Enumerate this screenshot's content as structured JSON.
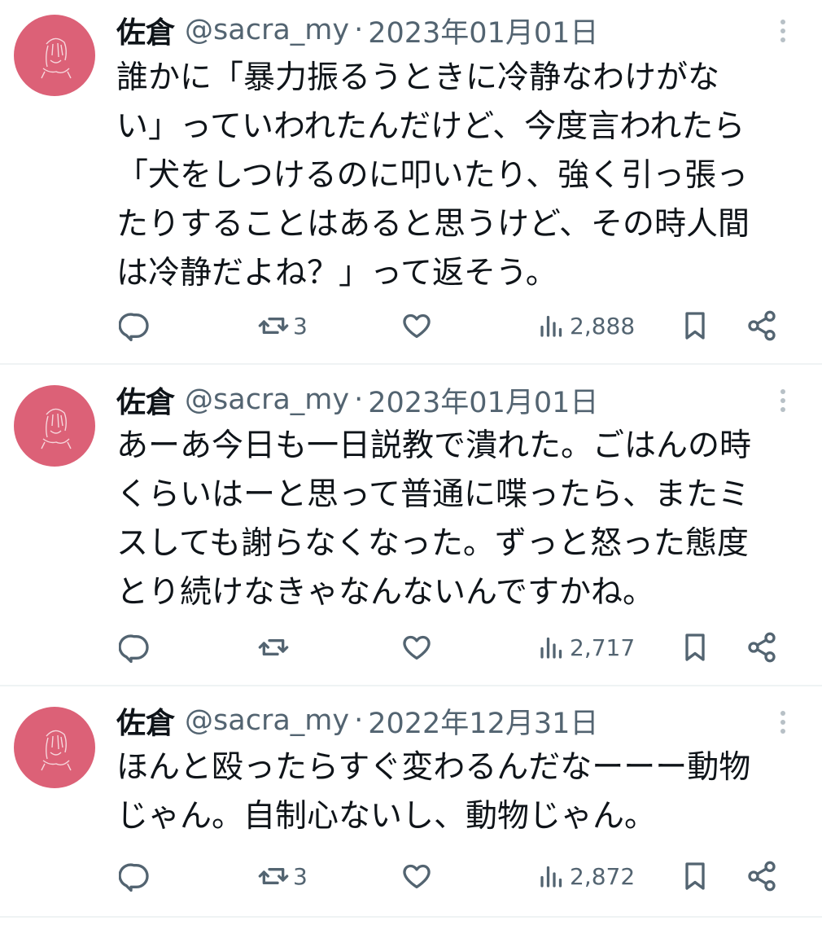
{
  "tweets": [
    {
      "name": "佐倉",
      "handle": "@sacra_my",
      "separator": "·",
      "date": "2023年01月01日",
      "lines": [
        "誰かに「暴力振るうときに冷静なわけがな",
        "い」っていわれたんだけど、今度言われたら",
        "「犬をしつけるのに叩いたり、強く引っ張っ",
        "たりすることはあると思うけど、その時人間",
        "は冷静だよね？」って返そう。"
      ],
      "retweets": "3",
      "likes": "",
      "views": "2,888"
    },
    {
      "name": "佐倉",
      "handle": "@sacra_my",
      "separator": "·",
      "date": "2023年01月01日",
      "lines": [
        "あーあ今日も一日説教で潰れた。ごはんの時",
        "くらいはーと思って普通に喋ったら、またミ",
        "スしても謝らなくなった。ずっと怒った態度",
        "とり続けなきゃなんないんですかね。"
      ],
      "retweets": "",
      "likes": "",
      "views": "2,717"
    },
    {
      "name": "佐倉",
      "handle": "@sacra_my",
      "separator": "·",
      "date": "2022年12月31日",
      "lines": [
        "ほんと殴ったらすぐ変わるんだなーーー動物",
        "じゃん。自制心ないし、動物じゃん。"
      ],
      "retweets": "3",
      "likes": "",
      "views": "2,872"
    }
  ],
  "icons": {
    "more": "more-vertical-icon",
    "reply": "reply-icon",
    "retweet": "retweet-icon",
    "like": "heart-icon",
    "views": "views-icon",
    "bookmark": "bookmark-icon",
    "share": "share-icon"
  },
  "colors": {
    "avatar": "#dc6177",
    "text": "#0f1419",
    "muted": "#536471",
    "divider": "#eff3f4"
  }
}
